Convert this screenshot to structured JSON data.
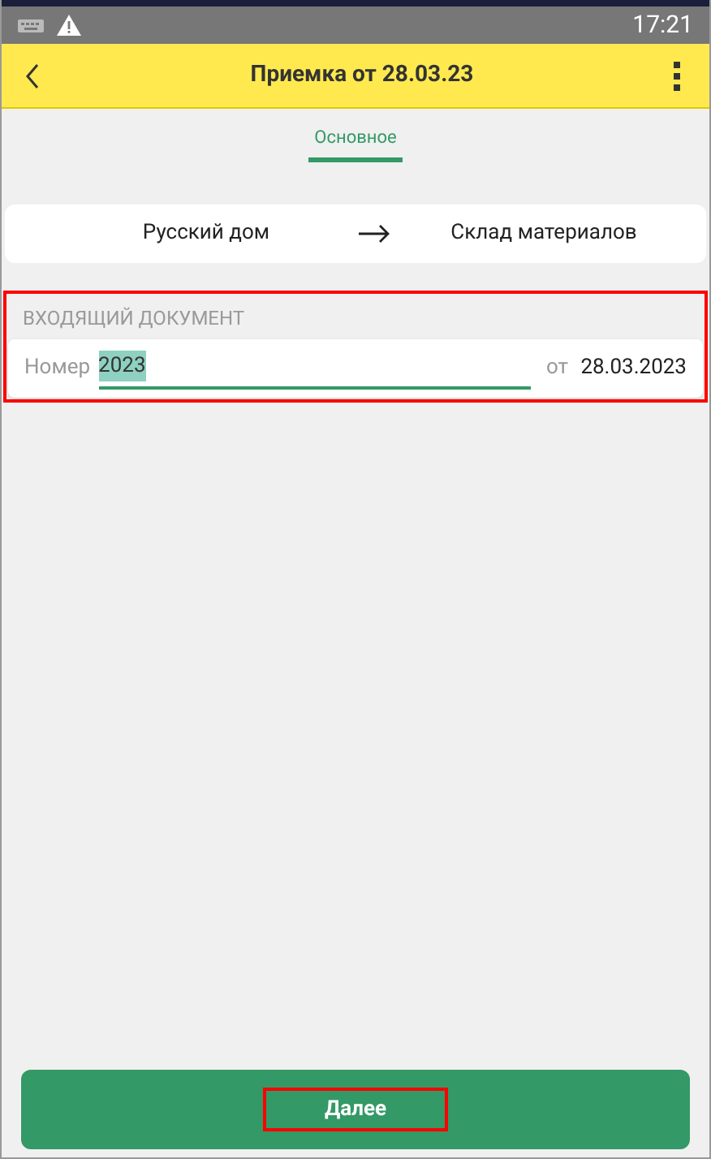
{
  "status_bar": {
    "time": "17:21"
  },
  "header": {
    "title": "Приемка от 28.03.23"
  },
  "tabs": [
    {
      "label": "Основное",
      "selected": true
    }
  ],
  "route": {
    "from": "Русский дом",
    "to": "Склад материалов"
  },
  "incoming_document": {
    "title": "ВХОДЯЩИЙ ДОКУМЕНТ",
    "highlighted": true,
    "number_label": "Номер",
    "number_value": "2023",
    "number_selected": true,
    "date_label": "от",
    "date_value": "28.03.2023"
  },
  "next_button": {
    "label": "Далее",
    "highlighted": true
  }
}
